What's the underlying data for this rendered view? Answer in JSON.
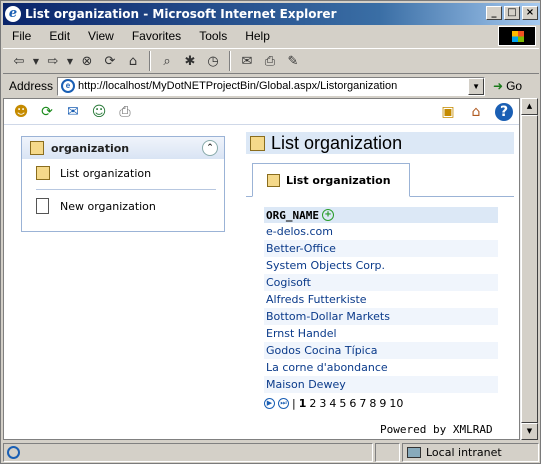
{
  "window": {
    "title": "List organization - Microsoft Internet Explorer"
  },
  "menu": [
    "File",
    "Edit",
    "View",
    "Favorites",
    "Tools",
    "Help"
  ],
  "address": {
    "label": "Address",
    "url": "http://localhost/MyDotNETProjectBin/Global.aspx/Listorganization",
    "go": "Go"
  },
  "left_panel": {
    "header": "organization",
    "items": [
      "List organization",
      "New organization"
    ]
  },
  "right_panel": {
    "title": "List organization",
    "tab": "List organization",
    "grid": {
      "column": "ORG_NAME",
      "rows": [
        "e-delos.com",
        "Better-Office",
        "System Objects Corp.",
        "Cogisoft",
        "Alfreds Futterkiste",
        "Bottom-Dollar Markets",
        "Ernst Handel",
        "Godos Cocina Típica",
        "La corne d'abondance",
        "Maison Dewey"
      ]
    },
    "pager": {
      "separator": "|",
      "pages": [
        "1",
        "2",
        "3",
        "4",
        "5",
        "6",
        "7",
        "8",
        "9",
        "10"
      ],
      "current": "1"
    }
  },
  "powered_by": "Powered by XMLRAD",
  "status": {
    "zone": "Local intranet"
  }
}
